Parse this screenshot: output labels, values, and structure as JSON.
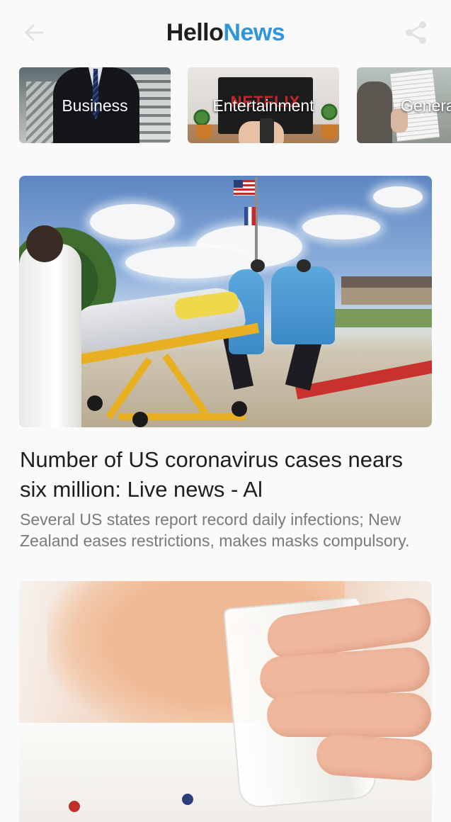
{
  "header": {
    "title_part1": "Hello",
    "title_part2": "News",
    "back_icon": "arrow-left-icon",
    "share_icon": "share-icon"
  },
  "categories": [
    {
      "label": "Business"
    },
    {
      "label": "Entertainment"
    },
    {
      "label": "General"
    }
  ],
  "articles": [
    {
      "title": "Number of US coronavirus cases nears six million: Live news - Al",
      "description": "Several US states report record daily infections; New Zealand eases restrictions, makes masks compulsory."
    }
  ],
  "colors": {
    "brand_dark": "#1f1f1f",
    "brand_accent": "#2f95dc",
    "background": "#fafafa",
    "description_text": "#7a7a7a"
  }
}
